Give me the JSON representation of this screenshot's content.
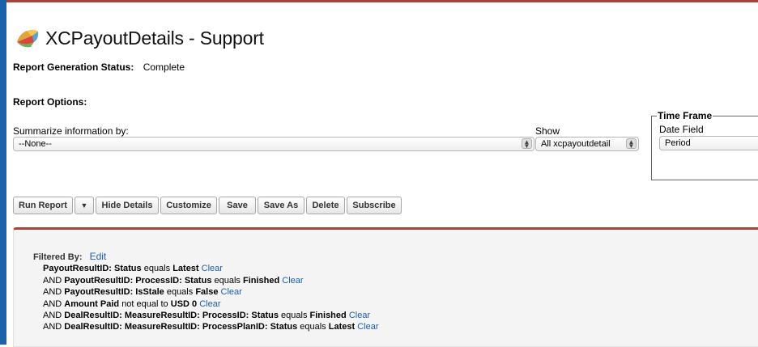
{
  "page": {
    "title": "XCPayoutDetails - Support",
    "logo_icon": "salesforce-reports-icon"
  },
  "status": {
    "label": "Report Generation Status:",
    "value": "Complete"
  },
  "options": {
    "heading": "Report Options:",
    "summarize_label": "Summarize information by:",
    "summarize_value": "--None--",
    "show_label": "Show",
    "show_value": "All xcpayoutdetail"
  },
  "timeframe": {
    "legend": "Time Frame",
    "date_field_label": "Date Field",
    "date_field_value": "Period"
  },
  "toolbar": {
    "run_report": "Run Report",
    "run_dropdown": "▼",
    "hide_details": "Hide Details",
    "customize": "Customize",
    "save": "Save",
    "save_as": "Save As",
    "delete": "Delete",
    "subscribe": "Subscribe"
  },
  "filters": {
    "heading": "Filtered By:",
    "edit": "Edit",
    "clear_label": "Clear",
    "lines": [
      {
        "prefix": "",
        "field": "PayoutResultID: Status",
        "op": "equals",
        "value": "Latest"
      },
      {
        "prefix": "AND ",
        "field": "PayoutResultID: ProcessID: Status",
        "op": "equals",
        "value": "Finished"
      },
      {
        "prefix": "AND ",
        "field": "PayoutResultID: IsStale",
        "op": "equals",
        "value": "False"
      },
      {
        "prefix": "AND ",
        "field": "Amount Paid",
        "op": "not equal to",
        "value": "USD 0"
      },
      {
        "prefix": "AND ",
        "field": "DealResultID: MeasureResultID: ProcessID: Status",
        "op": "equals",
        "value": "Finished"
      },
      {
        "prefix": "AND ",
        "field": "DealResultID: MeasureResultID: ProcessPlanID: Status",
        "op": "equals",
        "value": "Latest"
      }
    ]
  },
  "colors": {
    "accent_red": "#a4443a",
    "link_blue": "#1f5ea8",
    "edge_blue": "#1b62a8"
  }
}
